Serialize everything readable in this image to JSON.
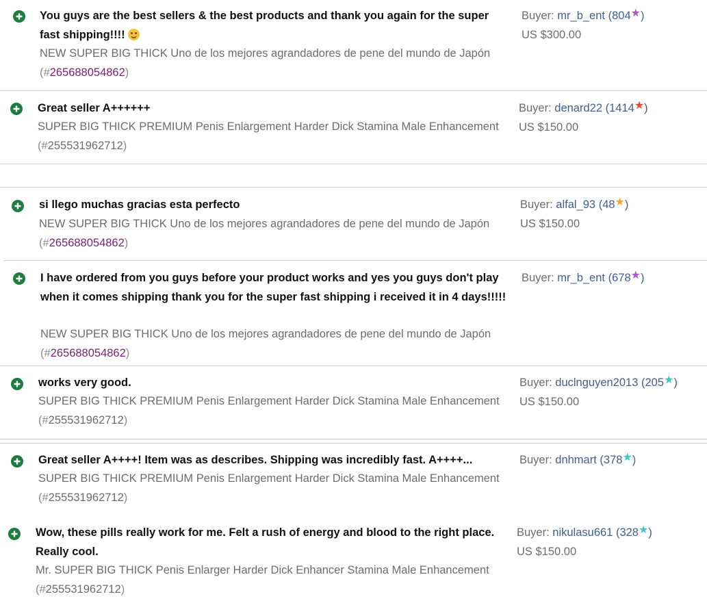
{
  "buyer_label": "Buyer:",
  "colors": {
    "plus_icon": "#1d7c3f",
    "star_purple": "#b554c6",
    "star_red": "#e0463c",
    "star_orange": "#f2a531",
    "star_teal": "#3cc6c6",
    "item_id_link": "#7a1f72"
  },
  "entries": [
    {
      "comment": "You guys are the best sellers & the best products and thank you again for the super fast shipping!!!!",
      "emoji": "smiling-face-emoji",
      "item_title": "NEW SUPER BIG THICK Uno de los mejores agrandadores de pene del mundo de Japón",
      "item_id_open": "(#",
      "item_id": "265688054862",
      "item_id_close": ")",
      "buyer": "mr_b_ent",
      "score": "804",
      "star_color": "purple",
      "price": "US $300.00"
    },
    {
      "comment": "Great seller A++++++",
      "item_title": "SUPER BIG THICK PREMIUM Penis Enlargement Harder Dick Stamina Male Enhancement",
      "item_id_open": "(#",
      "item_id": "255531962712",
      "item_id_close": ")",
      "buyer": "denard22",
      "score": "1414",
      "star_color": "red",
      "price": "US $150.00"
    },
    {
      "comment": "si llego muchas gracias esta perfecto",
      "item_title": "NEW SUPER BIG THICK Uno de los mejores agrandadores de pene del mundo de Japón",
      "item_id_open": "(#",
      "item_id": "265688054862",
      "item_id_close": ")",
      "buyer": "alfal_93",
      "score": "48",
      "star_color": "orange",
      "price": "US $150.00"
    },
    {
      "comment": "I have ordered from you guys before your product works and yes you guys don't play when it comes shipping thank you for the super fast shipping i received it in 4 days!!!!!",
      "item_title": "NEW SUPER BIG THICK Uno de los mejores agrandadores de pene del mundo de Japón",
      "item_id_open": "(#",
      "item_id": "265688054862",
      "item_id_close": ")",
      "buyer": "mr_b_ent",
      "score": "678",
      "star_color": "purple",
      "price": ""
    },
    {
      "comment": "works very good.",
      "item_title": "SUPER BIG THICK PREMIUM Penis Enlargement Harder Dick Stamina Male Enhancement",
      "item_id_open": "(#",
      "item_id": "255531962712",
      "item_id_close": ")",
      "buyer": "duclnguyen2013",
      "score": "205",
      "star_color": "teal",
      "price": "US $150.00"
    },
    {
      "comment": "Great seller A++++! Item was as describes. Shipping was incredibly fast. A++++...",
      "item_title": "SUPER BIG THICK PREMIUM Penis Enlargement Harder Dick Stamina Male Enhancement",
      "item_id_open": "(#",
      "item_id": "255531962712",
      "item_id_close": ")",
      "buyer": "dnhmart",
      "score": "378",
      "star_color": "teal",
      "price": ""
    },
    {
      "comment": "Wow, these pills really work for me. Felt a rush of energy and blood to the right place. Really cool.",
      "item_title": "Mr. SUPER BIG THICK Penis Enlarger Harder Dick Enhancer Stamina Male Enhancement",
      "item_id_open": "(#",
      "item_id": "255531962712",
      "item_id_close": ")",
      "buyer": "nikulasu661",
      "score": "328",
      "star_color": "teal",
      "price": "US $150.00"
    }
  ]
}
